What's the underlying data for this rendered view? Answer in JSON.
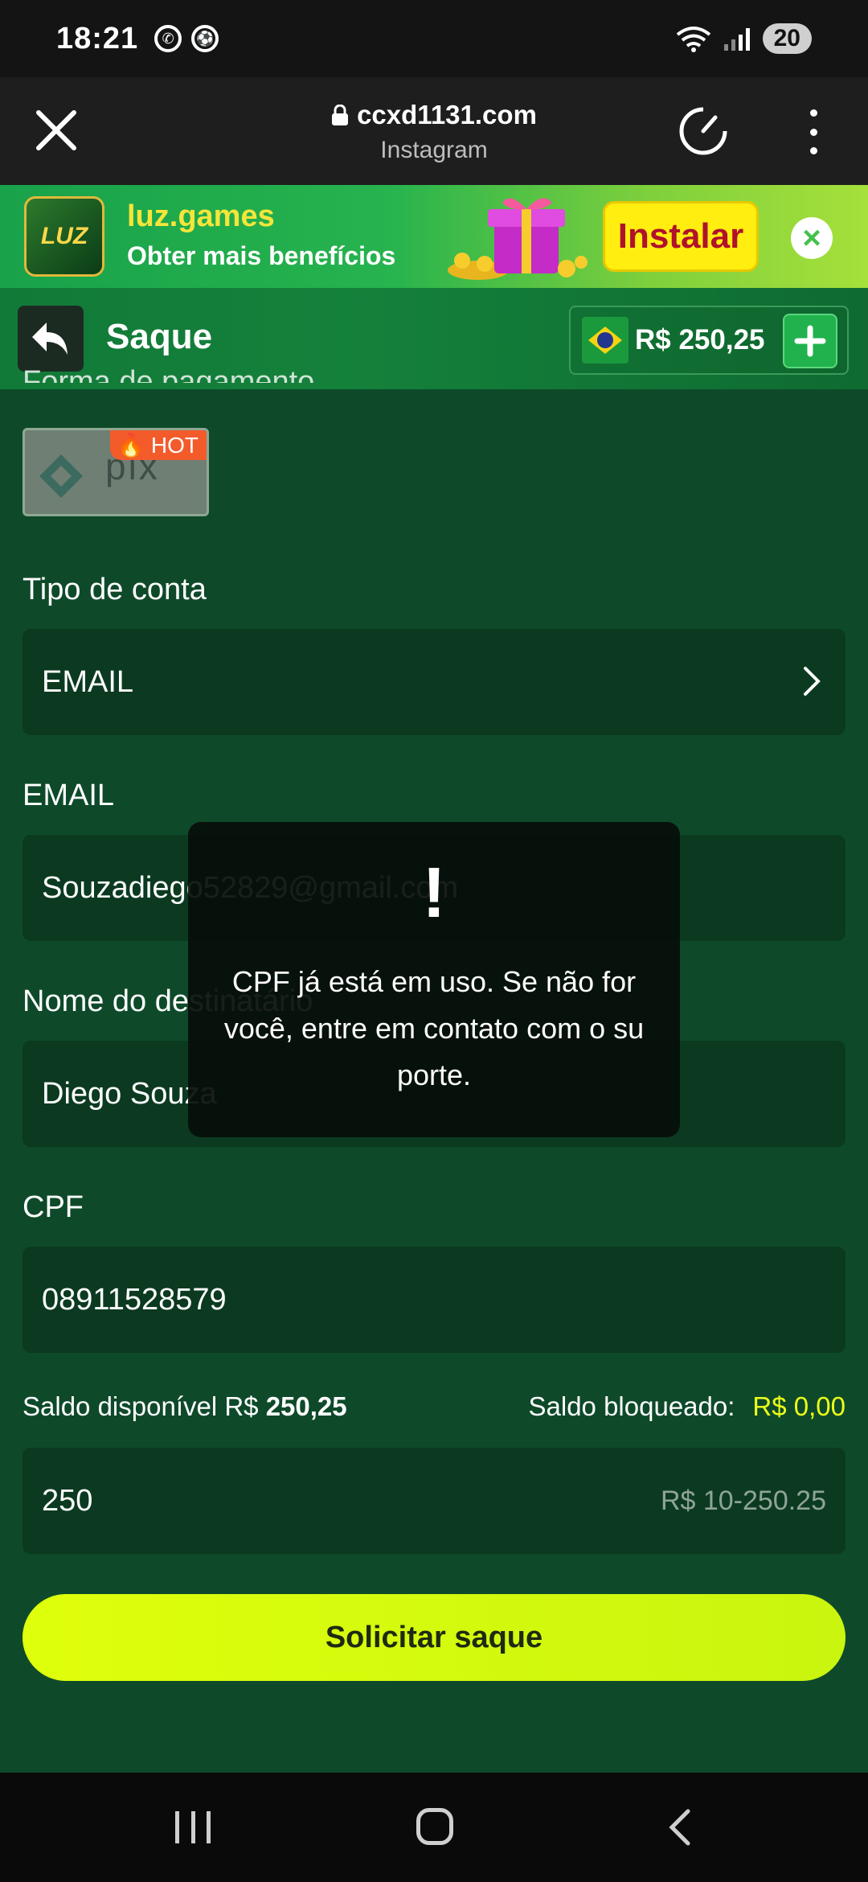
{
  "status_bar": {
    "time": "18:21",
    "battery": "20",
    "network": "5"
  },
  "browser": {
    "host": "ccxd1131.com",
    "source": "Instagram"
  },
  "banner": {
    "app_name": "luz.games",
    "tagline": "Obter mais benefícios",
    "install_label": "Instalar",
    "logo_text": "LUZ"
  },
  "header": {
    "title": "Saque",
    "balance": "R$ 250,25"
  },
  "form": {
    "payment_label": "Forma de pagamento",
    "pix_text": "pix",
    "hot_badge": "HOT",
    "account_type_label": "Tipo de conta",
    "account_type_value": "EMAIL",
    "email_label": "EMAIL",
    "email_value": "Souzadiego52829@gmail.com",
    "recipient_label": "Nome do destinatário",
    "recipient_value": "Diego Souza",
    "cpf_label": "CPF",
    "cpf_value": "08911528579",
    "available_label": "Saldo disponível R$",
    "available_value": "250,25",
    "blocked_label": "Saldo bloqueado:",
    "blocked_value": "R$ 0,00",
    "amount_value": "250",
    "amount_range": "R$ 10-250.25",
    "submit_label": "Solicitar saque"
  },
  "toast": {
    "icon": "!",
    "message": "CPF já está em uso. Se não for você, entre em contato com o suporte."
  },
  "colors": {
    "page_bg": "#0e4a2a",
    "field_bg": "#0b3a20",
    "accent_lime": "#dfff0c",
    "blocked_yellow": "#ecff1a"
  }
}
